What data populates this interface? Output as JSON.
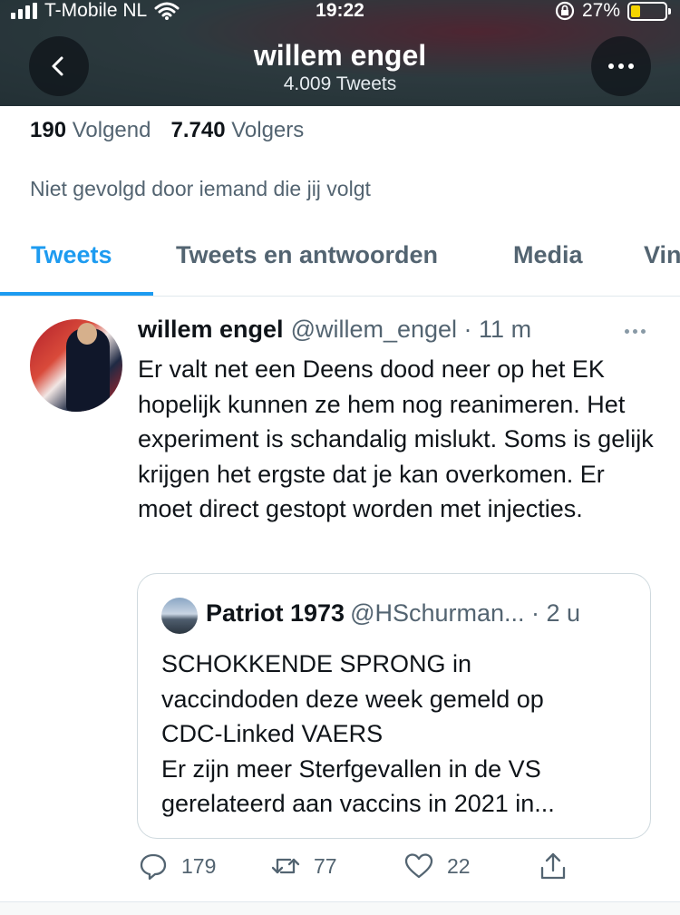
{
  "status_bar": {
    "carrier": "T-Mobile NL",
    "time": "19:22",
    "battery": "27%",
    "battery_level": 0.27
  },
  "profile_header": {
    "name": "willem engel",
    "tweet_count": "4.009 Tweets"
  },
  "stats": {
    "following_count": "190",
    "following_label": "Volgend",
    "followers_count": "7.740",
    "followers_label": "Volgers"
  },
  "not_followed_text": "Niet gevolgd door iemand die jij volgt",
  "tabs": [
    {
      "label": "Tweets",
      "active": true
    },
    {
      "label": "Tweets en antwoorden",
      "active": false
    },
    {
      "label": "Media",
      "active": false
    },
    {
      "label": "Vin",
      "active": false
    }
  ],
  "tweet": {
    "author": "willem engel",
    "handle_time": "@willem_engel · 11 m",
    "text": "Er valt net een Deens dood neer op het EK hopelijk kunnen ze hem nog reanimeren. Het experiment is schandalig mislukt. Soms is gelijk krijgen het ergste dat je kan overkomen. Er moet direct gestopt worden met injecties.",
    "quote": {
      "author": "Patriot 1973",
      "handle_time": "@HSchurman... · 2 u",
      "text_lines": [
        "SCHOKKENDE SPRONG in",
        "vaccindoden deze week gemeld op",
        "CDC-Linked VAERS",
        "Er zijn meer Sterfgevallen in de VS",
        "gerelateerd aan vaccins in 2021 in..."
      ]
    },
    "actions": {
      "replies": "179",
      "retweets": "77",
      "likes": "22"
    }
  },
  "icons": {
    "back": "chevron-left-icon",
    "more": "more-horizontal-icon",
    "reply": "reply-bubble-icon",
    "retweet": "retweet-icon",
    "like": "heart-icon",
    "share": "share-icon",
    "wifi": "wifi-icon",
    "rotation_lock": "rotation-lock-icon"
  },
  "colors": {
    "accent": "#1d9bf0",
    "battery_low": "#f5d400",
    "secondary_text": "#536471"
  }
}
